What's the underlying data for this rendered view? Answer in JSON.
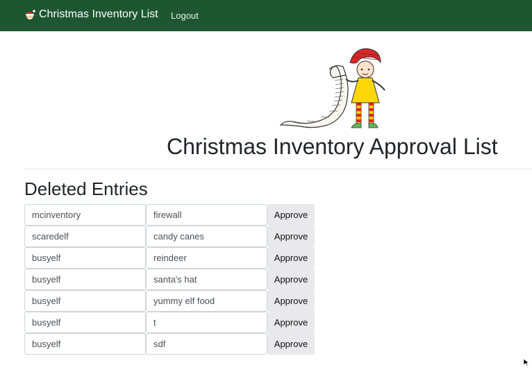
{
  "navbar": {
    "brand_label": "Christmas Inventory List",
    "brand_icon": "santa-hat-icon",
    "logout_label": "Logout",
    "background": "#1e5631"
  },
  "header": {
    "illustration": "elf-with-scroll-illustration",
    "title": "Christmas Inventory Approval List"
  },
  "section": {
    "title": "Deleted Entries"
  },
  "entries": [
    {
      "user": "mcinventory",
      "item": "firewall",
      "action": "Approve"
    },
    {
      "user": "scaredelf",
      "item": "candy canes",
      "action": "Approve"
    },
    {
      "user": "busyelf",
      "item": "reindeer",
      "action": "Approve"
    },
    {
      "user": "busyelf",
      "item": "santa's hat",
      "action": "Approve"
    },
    {
      "user": "busyelf",
      "item": "yummy elf food",
      "action": "Approve"
    },
    {
      "user": "busyelf",
      "item": "t",
      "action": "Approve"
    },
    {
      "user": "busyelf",
      "item": "sdf",
      "action": "Approve"
    }
  ]
}
